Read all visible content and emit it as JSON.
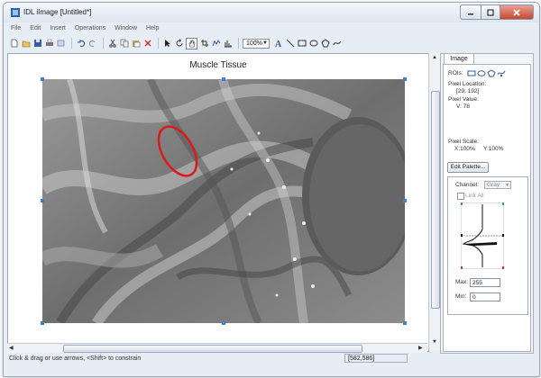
{
  "window": {
    "title": "IDL iImage [Untitled*]"
  },
  "menu": [
    "File",
    "Edit",
    "Insert",
    "Operations",
    "Window",
    "Help"
  ],
  "toolbar": {
    "zoom": "100%"
  },
  "canvas": {
    "image_title": "Muscle Tissue"
  },
  "status": {
    "hint": "Click & drag or use arrows, <Shift> to constrain",
    "coords": "[582,586]"
  },
  "panel": {
    "tab": "Image",
    "rois_label": "ROIs:",
    "pixel_location_label": "Pixel Location:",
    "pixel_location_value": "[29, 192]",
    "pixel_value_label": "Pixel Value:",
    "pixel_value": "V: 78",
    "pixel_scale_label": "Pixel Scale:",
    "pixel_scale_x": "X:100%",
    "pixel_scale_y": "Y:100%",
    "edit_palette": "Edit Palette...",
    "channel_label": "Channel:",
    "channel_value": "Gray",
    "link_all": "Link All",
    "max_label": "Max:",
    "max_value": "255",
    "min_label": "Min:",
    "min_value": "0"
  },
  "colors": {
    "handle": "#3b7fd8",
    "roi": "#d81b1b",
    "histogram": "#111111"
  }
}
